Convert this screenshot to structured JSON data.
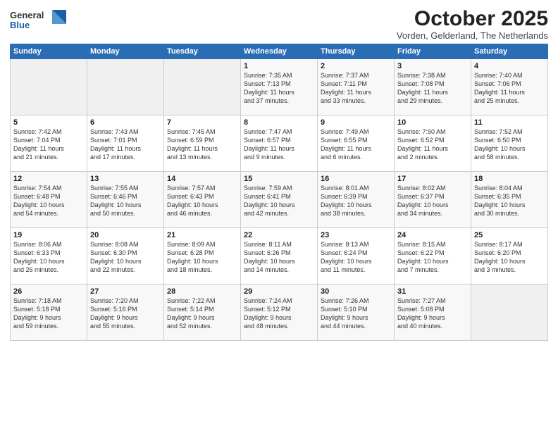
{
  "header": {
    "logo_line1": "General",
    "logo_line2": "Blue",
    "month": "October 2025",
    "location": "Vorden, Gelderland, The Netherlands"
  },
  "weekdays": [
    "Sunday",
    "Monday",
    "Tuesday",
    "Wednesday",
    "Thursday",
    "Friday",
    "Saturday"
  ],
  "weeks": [
    [
      {
        "day": "",
        "info": ""
      },
      {
        "day": "",
        "info": ""
      },
      {
        "day": "",
        "info": ""
      },
      {
        "day": "1",
        "info": "Sunrise: 7:35 AM\nSunset: 7:13 PM\nDaylight: 11 hours\nand 37 minutes."
      },
      {
        "day": "2",
        "info": "Sunrise: 7:37 AM\nSunset: 7:11 PM\nDaylight: 11 hours\nand 33 minutes."
      },
      {
        "day": "3",
        "info": "Sunrise: 7:38 AM\nSunset: 7:08 PM\nDaylight: 11 hours\nand 29 minutes."
      },
      {
        "day": "4",
        "info": "Sunrise: 7:40 AM\nSunset: 7:06 PM\nDaylight: 11 hours\nand 25 minutes."
      }
    ],
    [
      {
        "day": "5",
        "info": "Sunrise: 7:42 AM\nSunset: 7:04 PM\nDaylight: 11 hours\nand 21 minutes."
      },
      {
        "day": "6",
        "info": "Sunrise: 7:43 AM\nSunset: 7:01 PM\nDaylight: 11 hours\nand 17 minutes."
      },
      {
        "day": "7",
        "info": "Sunrise: 7:45 AM\nSunset: 6:59 PM\nDaylight: 11 hours\nand 13 minutes."
      },
      {
        "day": "8",
        "info": "Sunrise: 7:47 AM\nSunset: 6:57 PM\nDaylight: 11 hours\nand 9 minutes."
      },
      {
        "day": "9",
        "info": "Sunrise: 7:49 AM\nSunset: 6:55 PM\nDaylight: 11 hours\nand 6 minutes."
      },
      {
        "day": "10",
        "info": "Sunrise: 7:50 AM\nSunset: 6:52 PM\nDaylight: 11 hours\nand 2 minutes."
      },
      {
        "day": "11",
        "info": "Sunrise: 7:52 AM\nSunset: 6:50 PM\nDaylight: 10 hours\nand 58 minutes."
      }
    ],
    [
      {
        "day": "12",
        "info": "Sunrise: 7:54 AM\nSunset: 6:48 PM\nDaylight: 10 hours\nand 54 minutes."
      },
      {
        "day": "13",
        "info": "Sunrise: 7:55 AM\nSunset: 6:46 PM\nDaylight: 10 hours\nand 50 minutes."
      },
      {
        "day": "14",
        "info": "Sunrise: 7:57 AM\nSunset: 6:43 PM\nDaylight: 10 hours\nand 46 minutes."
      },
      {
        "day": "15",
        "info": "Sunrise: 7:59 AM\nSunset: 6:41 PM\nDaylight: 10 hours\nand 42 minutes."
      },
      {
        "day": "16",
        "info": "Sunrise: 8:01 AM\nSunset: 6:39 PM\nDaylight: 10 hours\nand 38 minutes."
      },
      {
        "day": "17",
        "info": "Sunrise: 8:02 AM\nSunset: 6:37 PM\nDaylight: 10 hours\nand 34 minutes."
      },
      {
        "day": "18",
        "info": "Sunrise: 8:04 AM\nSunset: 6:35 PM\nDaylight: 10 hours\nand 30 minutes."
      }
    ],
    [
      {
        "day": "19",
        "info": "Sunrise: 8:06 AM\nSunset: 6:33 PM\nDaylight: 10 hours\nand 26 minutes."
      },
      {
        "day": "20",
        "info": "Sunrise: 8:08 AM\nSunset: 6:30 PM\nDaylight: 10 hours\nand 22 minutes."
      },
      {
        "day": "21",
        "info": "Sunrise: 8:09 AM\nSunset: 6:28 PM\nDaylight: 10 hours\nand 18 minutes."
      },
      {
        "day": "22",
        "info": "Sunrise: 8:11 AM\nSunset: 6:26 PM\nDaylight: 10 hours\nand 14 minutes."
      },
      {
        "day": "23",
        "info": "Sunrise: 8:13 AM\nSunset: 6:24 PM\nDaylight: 10 hours\nand 11 minutes."
      },
      {
        "day": "24",
        "info": "Sunrise: 8:15 AM\nSunset: 6:22 PM\nDaylight: 10 hours\nand 7 minutes."
      },
      {
        "day": "25",
        "info": "Sunrise: 8:17 AM\nSunset: 6:20 PM\nDaylight: 10 hours\nand 3 minutes."
      }
    ],
    [
      {
        "day": "26",
        "info": "Sunrise: 7:18 AM\nSunset: 5:18 PM\nDaylight: 9 hours\nand 59 minutes."
      },
      {
        "day": "27",
        "info": "Sunrise: 7:20 AM\nSunset: 5:16 PM\nDaylight: 9 hours\nand 55 minutes."
      },
      {
        "day": "28",
        "info": "Sunrise: 7:22 AM\nSunset: 5:14 PM\nDaylight: 9 hours\nand 52 minutes."
      },
      {
        "day": "29",
        "info": "Sunrise: 7:24 AM\nSunset: 5:12 PM\nDaylight: 9 hours\nand 48 minutes."
      },
      {
        "day": "30",
        "info": "Sunrise: 7:26 AM\nSunset: 5:10 PM\nDaylight: 9 hours\nand 44 minutes."
      },
      {
        "day": "31",
        "info": "Sunrise: 7:27 AM\nSunset: 5:08 PM\nDaylight: 9 hours\nand 40 minutes."
      },
      {
        "day": "",
        "info": ""
      }
    ]
  ]
}
